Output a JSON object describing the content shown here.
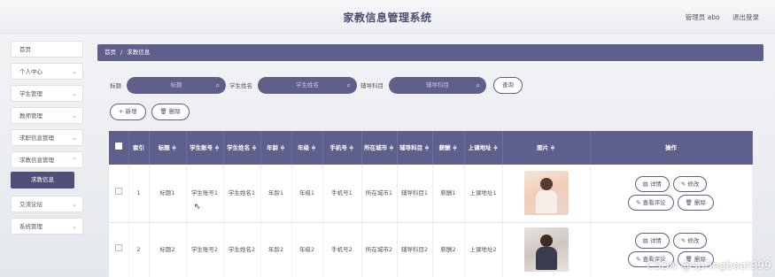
{
  "header": {
    "title": "家教信息管理系统",
    "admin_label": "管理员 abo",
    "logout_label": "退出登录"
  },
  "sidebar": {
    "items": [
      {
        "label": "首页",
        "has_children": false
      },
      {
        "label": "个人中心",
        "has_children": true
      },
      {
        "label": "学生管理",
        "has_children": true
      },
      {
        "label": "教师管理",
        "has_children": true
      },
      {
        "label": "求职信息管理",
        "has_children": true
      },
      {
        "label": "求教信息管理",
        "has_children": true,
        "expanded": true
      },
      {
        "label": "交流论坛",
        "has_children": true
      },
      {
        "label": "系统管理",
        "has_children": true
      }
    ],
    "active_sub": "求教信息",
    "chevron": "chevron-down-icon"
  },
  "breadcrumb": {
    "home": "首页",
    "separator": "/",
    "current": "求教信息"
  },
  "search": {
    "label_title": "标题",
    "placeholder_title": "标题",
    "label_student": "学生姓名",
    "placeholder_student": "学生姓名",
    "label_subject": "辅导科目",
    "placeholder_subject": "辅导科目",
    "query_button": "查询"
  },
  "actions": {
    "add_label": "+ 新增",
    "delete_label": "删除"
  },
  "table": {
    "columns": [
      "索引",
      "标题 ≑",
      "学生账号 ≑",
      "学生姓名 ≑",
      "年龄 ≑",
      "年级 ≑",
      "手机号 ≑",
      "所在城市 ≑",
      "辅导科目 ≑",
      "薪酬 ≑",
      "上课地址 ≑",
      "图片 ≑",
      "操作"
    ],
    "rows": [
      {
        "index": "1",
        "title": "标题1",
        "account": "学生账号1",
        "name": "学生姓名1",
        "age": "年龄1",
        "grade": "年级1",
        "phone": "手机号1",
        "city": "所在城市1",
        "subject": "辅导科目1",
        "salary": "薪酬1",
        "address": "上课地址1"
      },
      {
        "index": "2",
        "title": "标题2",
        "account": "学生账号2",
        "name": "学生姓名2",
        "age": "年龄2",
        "grade": "年级2",
        "phone": "手机号2",
        "city": "所在城市2",
        "subject": "辅导科目2",
        "salary": "薪酬2",
        "address": "上课地址2"
      }
    ],
    "op_detail": "详情",
    "op_edit": "修改",
    "op_review": "查看评论",
    "op_delete": "删除"
  },
  "colors": {
    "accent": "#5e5f8b",
    "title": "#4c4d73"
  },
  "watermark": "CSDN @springboot999"
}
